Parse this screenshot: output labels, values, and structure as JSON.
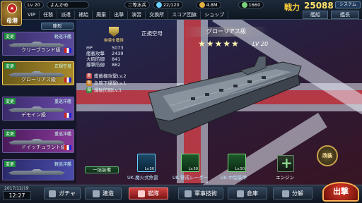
{
  "topbar": {
    "rank_label": "母港",
    "level_prefix": "Lv",
    "level": "20",
    "player_name": "よんかめ",
    "rank_title": "二等水兵",
    "fuel": "22/120",
    "ammo": "4.8M",
    "gems": "1660",
    "power_label": "戦力",
    "power_value": "25088",
    "system_label": "システム",
    "menu": [
      "VIP",
      "任務",
      "派遣",
      "補給",
      "廃棄",
      "出撃",
      "演習",
      "交換所",
      "スコア団旗",
      "ショップ"
    ],
    "right_tabs": [
      "艦船",
      "艦長"
    ],
    "colors": {
      "power": "#ffcf3a",
      "accent": "#c02020"
    }
  },
  "left_panel": {
    "sort_label": "陣形",
    "ships": [
      {
        "change": "変更",
        "class": "軽巡洋艦",
        "name": "クリーブランド級"
      },
      {
        "change": "変更",
        "class": "正規空母",
        "name": "グローリアス級"
      },
      {
        "change": "変更",
        "class": "重巡洋艦",
        "name": "デモイン級"
      },
      {
        "change": "変更",
        "class": "重巡洋艦",
        "name": "ドイッチュラント級"
      },
      {
        "change": "変更",
        "class": "軽巡洋艦",
        "name": ""
      }
    ]
  },
  "ship": {
    "medal_label": "勲章を獲得",
    "type": "正規空母",
    "name": "グローリアス級",
    "stars": "★★★★★",
    "level": "LV 20",
    "stats": [
      {
        "k": "HP",
        "v": "5073"
      },
      {
        "k": "艦載攻撃",
        "v": "2439"
      },
      {
        "k": "大砲防御",
        "v": "841"
      },
      {
        "k": "爆撃防御",
        "v": "862"
      }
    ],
    "skills": [
      {
        "icon": "艦",
        "label": "艦載機攻撃Lv.2"
      },
      {
        "icon": "急",
        "label": "急降下爆撃Lv.1"
      },
      {
        "icon": "爆",
        "label": "爆破防御Lv.1"
      }
    ]
  },
  "equipment": {
    "button_label": "一括装備",
    "slots": [
      {
        "name": "UK.魔火式魚雷",
        "lv": "Lv.50"
      },
      {
        "name": "UK.警戒レーダー",
        "lv": "Lv.50"
      },
      {
        "name": "UK.中型装甲",
        "lv": "Lv.50"
      }
    ],
    "engine_label": "エンジン",
    "remodel_label": "改装"
  },
  "bottombar": {
    "date": "2017/12/19",
    "time": "12:27",
    "nav": [
      "ガチャ",
      "建造",
      "艦隊",
      "軍事技術",
      "倉庫",
      "分解"
    ],
    "sortie_label": "出撃"
  }
}
